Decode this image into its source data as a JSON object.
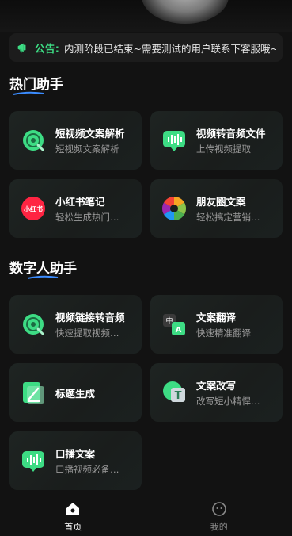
{
  "notice": {
    "label": "公告:",
    "text": "内测阶段已结束~需要测试的用户联系下客服哦~"
  },
  "sections": [
    {
      "title": "热门助手",
      "cards": [
        {
          "title": "短视频文案解析",
          "sub": "短视频文案解析",
          "icon": "disc-icon"
        },
        {
          "title": "视频转音频文件",
          "sub": "上传视频提取",
          "icon": "audio-wave-icon"
        },
        {
          "title": "小红书笔记",
          "sub": "轻松生成热门…",
          "icon": "xiaohongshu-icon",
          "icon_text": "小红书"
        },
        {
          "title": "朋友圈文案",
          "sub": "轻松搞定营销…",
          "icon": "camera-aperture-icon"
        }
      ]
    },
    {
      "title": "数字人助手",
      "cards": [
        {
          "title": "视频链接转音频",
          "sub": "快速提取视频…",
          "icon": "disc-icon"
        },
        {
          "title": "文案翻译",
          "sub": "快速精准翻译",
          "icon": "translate-icon",
          "icon_text": "中"
        },
        {
          "title": "标题生成",
          "sub": "",
          "icon": "edit-icon"
        },
        {
          "title": "文案改写",
          "sub": "改写短小精悍…",
          "icon": "text-icon",
          "icon_text": "T"
        },
        {
          "title": "口播文案",
          "sub": "口播视频必备…",
          "icon": "audio-wave-icon"
        }
      ]
    }
  ],
  "tabbar": {
    "home": "首页",
    "mine": "我的"
  },
  "colors": {
    "accent": "#3ddc84",
    "background": "#121212",
    "card": "#1c2020",
    "xiaohongshu": "#ff2442"
  }
}
